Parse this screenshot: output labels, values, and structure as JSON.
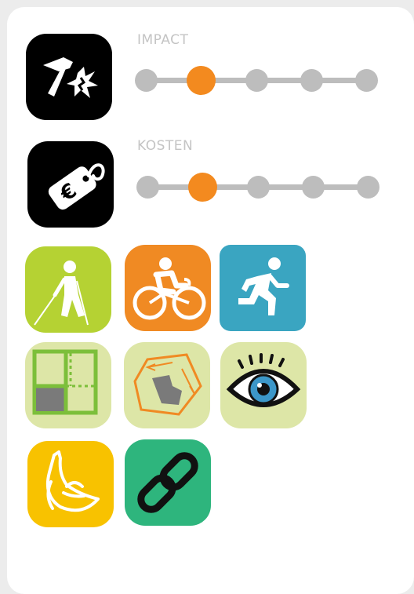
{
  "impact": {
    "label": "IMPACT",
    "level": 2,
    "steps": 5
  },
  "kosten": {
    "label": "KOSTEN",
    "level": 2,
    "steps": 5
  },
  "colors": {
    "accent": "#f38a1f",
    "track": "#bdbdbd",
    "label": "#c4c4c4",
    "walk": "#b5d233",
    "bike": "#f08a23",
    "run": "#3aa5c1",
    "pale": "#dde6a7",
    "banana": "#f8c200",
    "link": "#2eb57d"
  },
  "icons": [
    "hammer-impact-icon",
    "price-tag-euro-icon",
    "nordic-walking-icon",
    "cycling-icon",
    "running-icon",
    "floor-plan-icon",
    "area-map-icon",
    "eye-icon",
    "banana-icon",
    "chain-link-icon"
  ]
}
